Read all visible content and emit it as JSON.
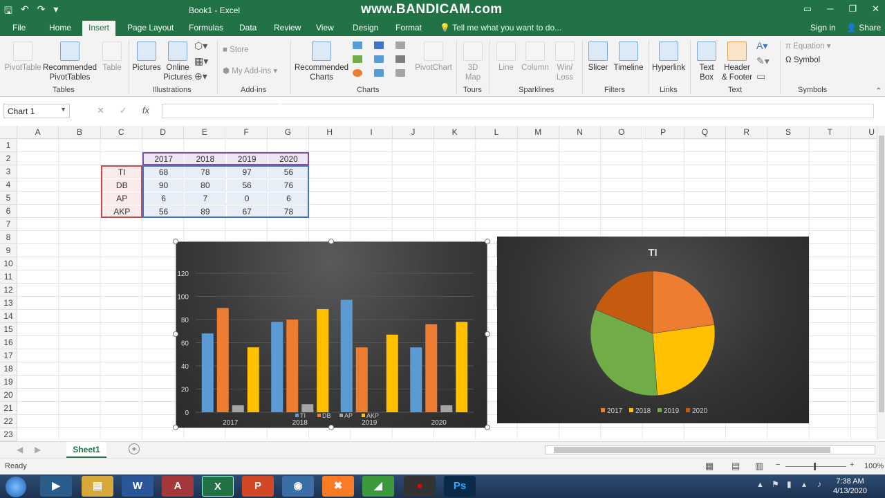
{
  "window": {
    "title": "Book1 - Excel",
    "watermark": "www.BANDICAM.com"
  },
  "tabs": [
    "File",
    "Home",
    "Insert",
    "Page Layout",
    "Formulas",
    "Data",
    "Review",
    "View",
    "Design",
    "Format"
  ],
  "active_tab": "Insert",
  "tell_me": "Tell me what you want to do...",
  "sign_in": "Sign in",
  "share": "Share",
  "ribbon": {
    "pivot_table": "PivotTable",
    "recommended_pivot": [
      "Recommended",
      "PivotTables"
    ],
    "table": "Table",
    "tables_group": "Tables",
    "pictures": "Pictures",
    "online_pictures": [
      "Online",
      "Pictures"
    ],
    "illustrations_group": "Illustrations",
    "store": "Store",
    "my_addins": "My Add-ins",
    "addins_group": "Add-ins",
    "recommended_charts": [
      "Recommended",
      "Charts"
    ],
    "pivot_chart": "PivotChart",
    "charts_group": "Charts",
    "map3d": [
      "3D",
      "Map"
    ],
    "tours_group": "Tours",
    "line": "Line",
    "column": "Column",
    "winloss": [
      "Win/",
      "Loss"
    ],
    "sparklines_group": "Sparklines",
    "slicer": "Slicer",
    "timeline": "Timeline",
    "filters_group": "Filters",
    "hyperlink": "Hyperlink",
    "links_group": "Links",
    "textbox": [
      "Text",
      "Box"
    ],
    "header_footer": [
      "Header",
      "& Footer"
    ],
    "text_group": "Text",
    "equation": "Equation",
    "symbol": "Symbol",
    "symbols_group": "Symbols"
  },
  "namebox": "Chart 1",
  "fx": "fx",
  "columns": [
    "A",
    "B",
    "C",
    "D",
    "E",
    "F",
    "G",
    "H",
    "I",
    "J",
    "K",
    "L",
    "M",
    "N",
    "O",
    "P",
    "Q",
    "R",
    "S",
    "T",
    "U"
  ],
  "rows": [
    "1",
    "2",
    "3",
    "4",
    "5",
    "6",
    "7",
    "8",
    "9",
    "10",
    "11",
    "12",
    "13",
    "14",
    "15",
    "16",
    "17",
    "18",
    "19",
    "20",
    "21",
    "22",
    "23"
  ],
  "table": {
    "years": [
      "2017",
      "2018",
      "2019",
      "2020"
    ],
    "subjects": [
      "TI",
      "DB",
      "AP",
      "AKP"
    ],
    "values": [
      [
        "68",
        "78",
        "97",
        "56"
      ],
      [
        "90",
        "80",
        "56",
        "76"
      ],
      [
        "6",
        "7",
        "0",
        "6"
      ],
      [
        "56",
        "89",
        "67",
        "78"
      ]
    ]
  },
  "chart_data": [
    {
      "type": "bar",
      "categories": [
        "2017",
        "2018",
        "2019",
        "2020"
      ],
      "series": [
        {
          "name": "TI",
          "values": [
            68,
            78,
            97,
            56
          ],
          "color": "#5b9bd5"
        },
        {
          "name": "DB",
          "values": [
            90,
            80,
            56,
            76
          ],
          "color": "#ed7d31"
        },
        {
          "name": "AP",
          "values": [
            6,
            7,
            0,
            6
          ],
          "color": "#a5a5a5"
        },
        {
          "name": "AKP",
          "values": [
            56,
            89,
            67,
            78
          ],
          "color": "#ffc000"
        }
      ],
      "ylim": [
        0,
        120
      ],
      "yticks": [
        0,
        20,
        40,
        60,
        80,
        100,
        120
      ],
      "legend": "bottom"
    },
    {
      "type": "pie",
      "title": "TI",
      "categories": [
        "2017",
        "2018",
        "2019",
        "2020"
      ],
      "values": [
        68,
        78,
        97,
        56
      ],
      "colors": [
        "#ed7d31",
        "#ffc000",
        "#70ad47",
        "#c55a11"
      ],
      "legend": "bottom"
    }
  ],
  "sheet_tab": "Sheet1",
  "status": {
    "ready": "Ready",
    "zoom": "100%"
  },
  "clock": {
    "time": "7:38 AM",
    "date": "4/13/2020"
  },
  "taskbar": [
    "Explorer",
    "Media",
    "Files",
    "Word",
    "Access",
    "Excel",
    "PowerPoint",
    "Chrome",
    "XAMPP",
    "Camtasia",
    "Record",
    "Photoshop"
  ]
}
